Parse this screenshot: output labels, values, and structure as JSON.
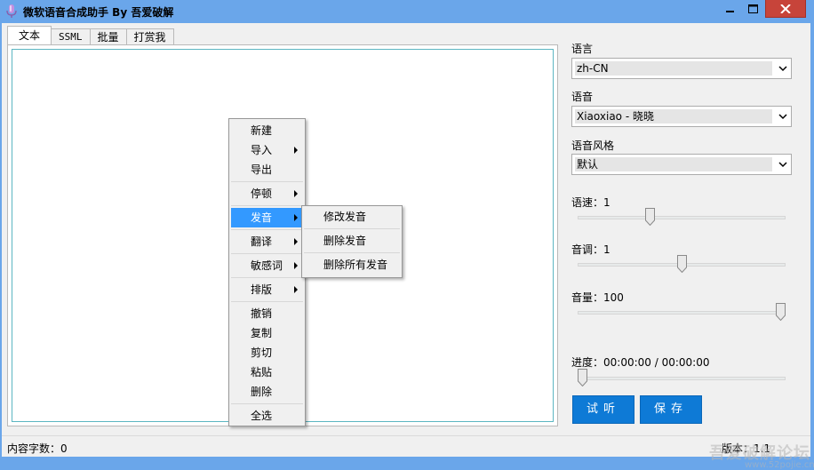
{
  "window": {
    "title": "微软语音合成助手 By 吾爱破解"
  },
  "tabs": [
    {
      "label": "文本"
    },
    {
      "label": "SSML"
    },
    {
      "label": "批量"
    },
    {
      "label": "打赏我"
    }
  ],
  "right_panel": {
    "language": {
      "label": "语言",
      "value": "zh-CN"
    },
    "voice": {
      "label": "语音",
      "value": "Xiaoxiao - 晓晓"
    },
    "style": {
      "label": "语音风格",
      "value": "默认"
    },
    "rate": {
      "label": "语速：",
      "value": "1",
      "level": 0.34
    },
    "pitch": {
      "label": "音调：",
      "value": "1",
      "level": 0.5
    },
    "volume": {
      "label": "音量：",
      "value": "100",
      "level": 1.0
    },
    "progress": {
      "label": "进度：",
      "value": "00:00:00 / 00:00:00",
      "level": 0.0
    },
    "listen_button": "试听",
    "save_button": "保存"
  },
  "context_menu": {
    "items": [
      "新建",
      "导入",
      "导出",
      "停顿",
      "发音",
      "翻译",
      "敏感词",
      "排版",
      "撤销",
      "复制",
      "剪切",
      "粘贴",
      "删除",
      "全选"
    ],
    "highlighted": "发音"
  },
  "submenu": {
    "items": [
      "修改发音",
      "删除发音",
      "删除所有发音"
    ]
  },
  "status": {
    "char_count": "内容字数：0",
    "version": "版本：1.1"
  },
  "watermark": {
    "text": "吾爱破解论坛",
    "sub": "www.52pojie.cn"
  },
  "colors": {
    "title_bar": "#6aa6ea",
    "close_button": "#c7443a",
    "accent_button": "#0e7ad6",
    "menu_highlight": "#3399ff"
  }
}
